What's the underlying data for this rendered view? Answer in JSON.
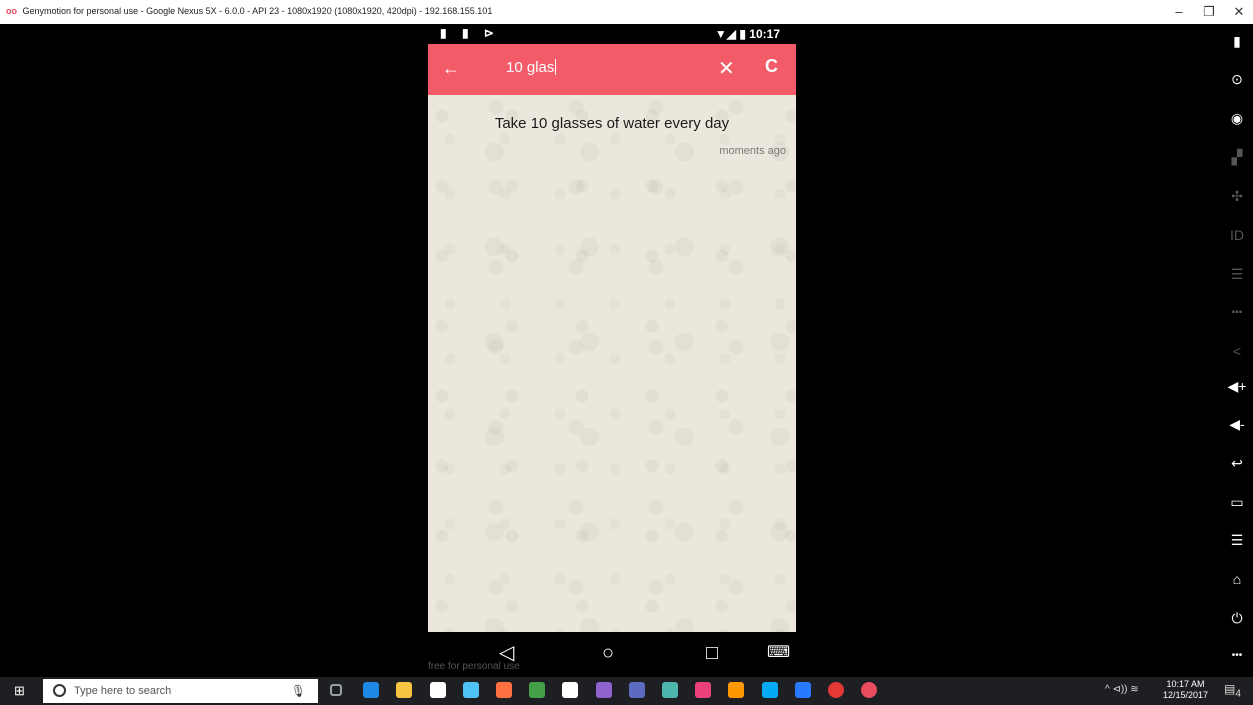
{
  "window": {
    "title": "Genymotion for personal use - Google Nexus 5X - 6.0.0 - API 23 - 1080x1920 (1080x1920, 420dpi) - 192.168.155.101",
    "logo": "oo",
    "minimize": "–",
    "restore": "❐",
    "close": "✕"
  },
  "statusbar": {
    "left_icons": "▮ ▮ ⊳",
    "right": "▼◢ ▮ 10:17"
  },
  "appbar": {
    "back_icon": "arrow-left-icon",
    "back_glyph": "←",
    "query": "10 glas",
    "clear_glyph": "✕",
    "refresh_glyph": "C"
  },
  "results": [
    {
      "text": "Take 10 glasses of water every day",
      "time": "moments ago"
    }
  ],
  "navbar": {
    "back": "◁",
    "home": "○",
    "recents": "□",
    "keyboard": "⌨"
  },
  "watermark": "free for personal use",
  "sidebar": [
    {
      "name": "battery-icon",
      "glyph": "▮"
    },
    {
      "name": "gps-icon",
      "glyph": "⊙"
    },
    {
      "name": "webcam-icon",
      "glyph": "◉"
    },
    {
      "name": "media-icon",
      "glyph": "▞"
    },
    {
      "name": "dpad-icon",
      "glyph": "✣"
    },
    {
      "name": "id-icon",
      "glyph": "ID"
    },
    {
      "name": "rss-icon",
      "glyph": "☰"
    },
    {
      "name": "sms-icon",
      "glyph": "▪▪▪"
    },
    {
      "name": "share-icon",
      "glyph": "<"
    },
    {
      "name": "volume-up-icon",
      "glyph": "◀+"
    },
    {
      "name": "volume-down-icon",
      "glyph": "◀-"
    },
    {
      "name": "back-icon",
      "glyph": "↩"
    },
    {
      "name": "recent-apps-icon",
      "glyph": "▭"
    },
    {
      "name": "menu-icon",
      "glyph": "☰"
    },
    {
      "name": "home-icon",
      "glyph": "⌂"
    },
    {
      "name": "power-icon",
      "glyph": "⏻"
    },
    {
      "name": "more-icon",
      "glyph": "•••"
    }
  ],
  "taskbar": {
    "search_placeholder": "Type here to search",
    "start_glyph": "⊞",
    "mic_glyph": "🎙",
    "tray": "^ ⊲)) ≋",
    "time": "10:17 AM",
    "date": "12/15/2017",
    "notifications": "4",
    "app_colors": [
      "#9aa0a6",
      "#1e88e5",
      "#f6c343",
      "#ffffff",
      "#4fc3f7",
      "#ff7043",
      "#43a047",
      "#ffffff",
      "#8e63ce",
      "#5c6bc0",
      "#4db6ac",
      "#ec407a",
      "#ff9800",
      "#03a9f4",
      "#2979ff",
      "#e53935",
      "#e94b5f"
    ]
  }
}
